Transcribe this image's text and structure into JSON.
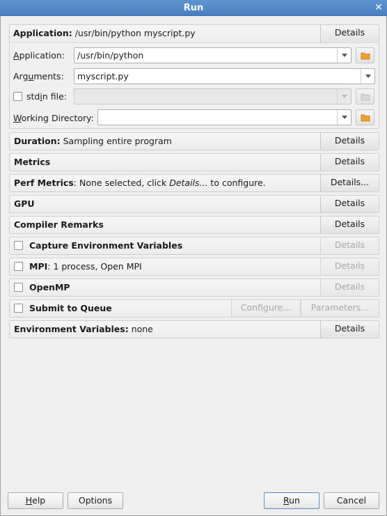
{
  "window": {
    "title": "Run",
    "close_glyph": "✕"
  },
  "application_section": {
    "heading_bold": "Application:",
    "heading_value": " /usr/bin/python myscript.py",
    "details_label": "Details",
    "fields": {
      "application_label_underline": "A",
      "application_label_rest": "pplication:",
      "application_value": "/usr/bin/python",
      "arguments_label_pre": "Arg",
      "arguments_label_underline": "u",
      "arguments_label_rest": "ments:",
      "arguments_value": "myscript.py",
      "stdin_label_pre": "std",
      "stdin_label_underline": "i",
      "stdin_label_rest": "n file:",
      "stdin_value": "",
      "workdir_label_underline": "W",
      "workdir_label_rest": "orking Directory:",
      "workdir_value": ""
    }
  },
  "rows": {
    "duration": {
      "bold": "Duration:",
      "text": " Sampling entire program",
      "button": "Details"
    },
    "metrics": {
      "bold": "Metrics",
      "button": "Details"
    },
    "perf_metrics": {
      "bold": "Perf Metrics",
      "text_a": ": None selected, click ",
      "text_italic": "Details...",
      "text_b": " to configure.",
      "button": "Details..."
    },
    "gpu": {
      "bold": "GPU",
      "button": "Details"
    },
    "compiler_remarks": {
      "bold": "Compiler Remarks",
      "button": "Details"
    },
    "capture_env": {
      "bold": "Capture Environment Variables",
      "button": "Details",
      "checked": false
    },
    "mpi": {
      "bold": "MPI",
      "text": ": 1 process, Open MPI",
      "button": "Details",
      "checked": false
    },
    "openmp": {
      "bold": "OpenMP",
      "button": "Details",
      "checked": false
    },
    "submit_queue": {
      "bold": "Submit to Queue",
      "configure": "Configure...",
      "parameters": "Parameters...",
      "checked": false
    },
    "env_vars": {
      "bold": "Environment Variables:",
      "text": " none",
      "button": "Details"
    }
  },
  "footer": {
    "help_underline": "H",
    "help_rest": "elp",
    "options_label": "Options",
    "run_underline": "R",
    "run_rest": "un",
    "cancel_label": "Cancel"
  },
  "colors": {
    "titlebar": "#4a80c0",
    "folder": "#f0a030"
  }
}
